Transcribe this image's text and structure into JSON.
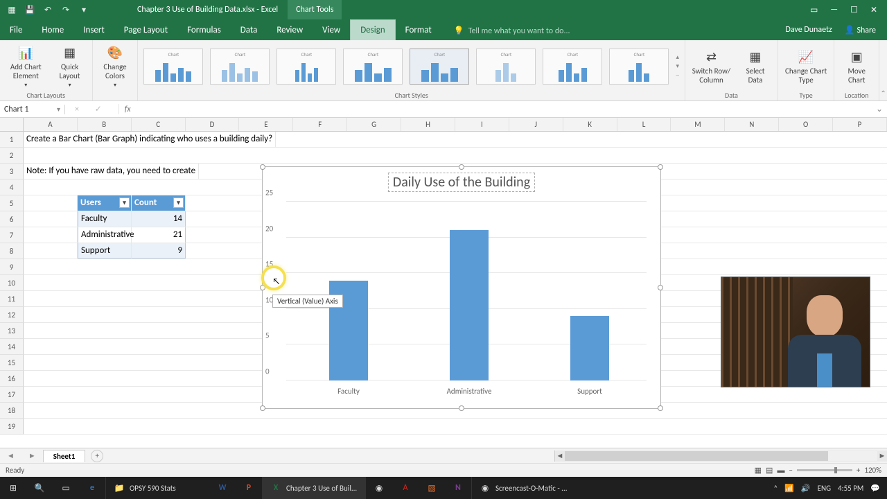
{
  "titlebar": {
    "docname": "Chapter 3 Use of Building Data.xlsx - Excel",
    "tools": "Chart Tools"
  },
  "menubar": {
    "tabs": [
      "File",
      "Home",
      "Insert",
      "Page Layout",
      "Formulas",
      "Data",
      "Review",
      "View",
      "Design",
      "Format"
    ],
    "tellme": "Tell me what you want to do...",
    "user": "Dave Dunaetz",
    "share": "Share"
  },
  "ribbon": {
    "addchart": "Add Chart Element",
    "quicklayout": "Quick Layout",
    "changecolors": "Change Colors",
    "chartlayouts": "Chart Layouts",
    "chartstyles": "Chart Styles",
    "switchrow": "Switch Row/ Column",
    "selectdata": "Select Data",
    "data": "Data",
    "changetype": "Change Chart Type",
    "type": "Type",
    "movechart": "Move Chart",
    "location": "Location"
  },
  "namebox": "Chart 1",
  "fxlabel": "fx",
  "columns": [
    "A",
    "B",
    "C",
    "D",
    "E",
    "F",
    "G",
    "H",
    "I",
    "J",
    "K",
    "L",
    "M",
    "N",
    "O",
    "P"
  ],
  "rows": [
    "1",
    "2",
    "3",
    "4",
    "5",
    "6",
    "7",
    "8",
    "9",
    "10",
    "11",
    "12",
    "13",
    "14",
    "15",
    "16",
    "17",
    "18",
    "19"
  ],
  "cells": {
    "a1": "Create a Bar Chart (Bar Graph) indicating who uses a building daily?",
    "a3": "Note: If you have raw data, you need to create",
    "b5": "Users",
    "c5": "Count",
    "b6": "Faculty",
    "c6": "14",
    "b7": "Administrative",
    "c7": "21",
    "b8": "Support",
    "c8": "9"
  },
  "chart": {
    "title": "Daily Use of the Building",
    "yticks": [
      "0",
      "5",
      "10",
      "15",
      "20",
      "25"
    ],
    "tooltip": "Vertical (Value) Axis"
  },
  "chart_data": {
    "type": "bar",
    "title": "Daily Use of the Building",
    "categories": [
      "Faculty",
      "Administrative",
      "Support"
    ],
    "values": [
      14,
      21,
      9
    ],
    "ylim": [
      0,
      25
    ],
    "xlabel": "",
    "ylabel": ""
  },
  "sheets": {
    "tab1": "Sheet1"
  },
  "statusbar": {
    "ready": "Ready",
    "zoom": "120%"
  },
  "taskbar": {
    "folder": "OPSY 590 Stats",
    "excel": "Chapter 3 Use of Buil...",
    "som": "Screencast-O-Matic - ...",
    "lang": "ENG",
    "time": "4:55 PM"
  }
}
